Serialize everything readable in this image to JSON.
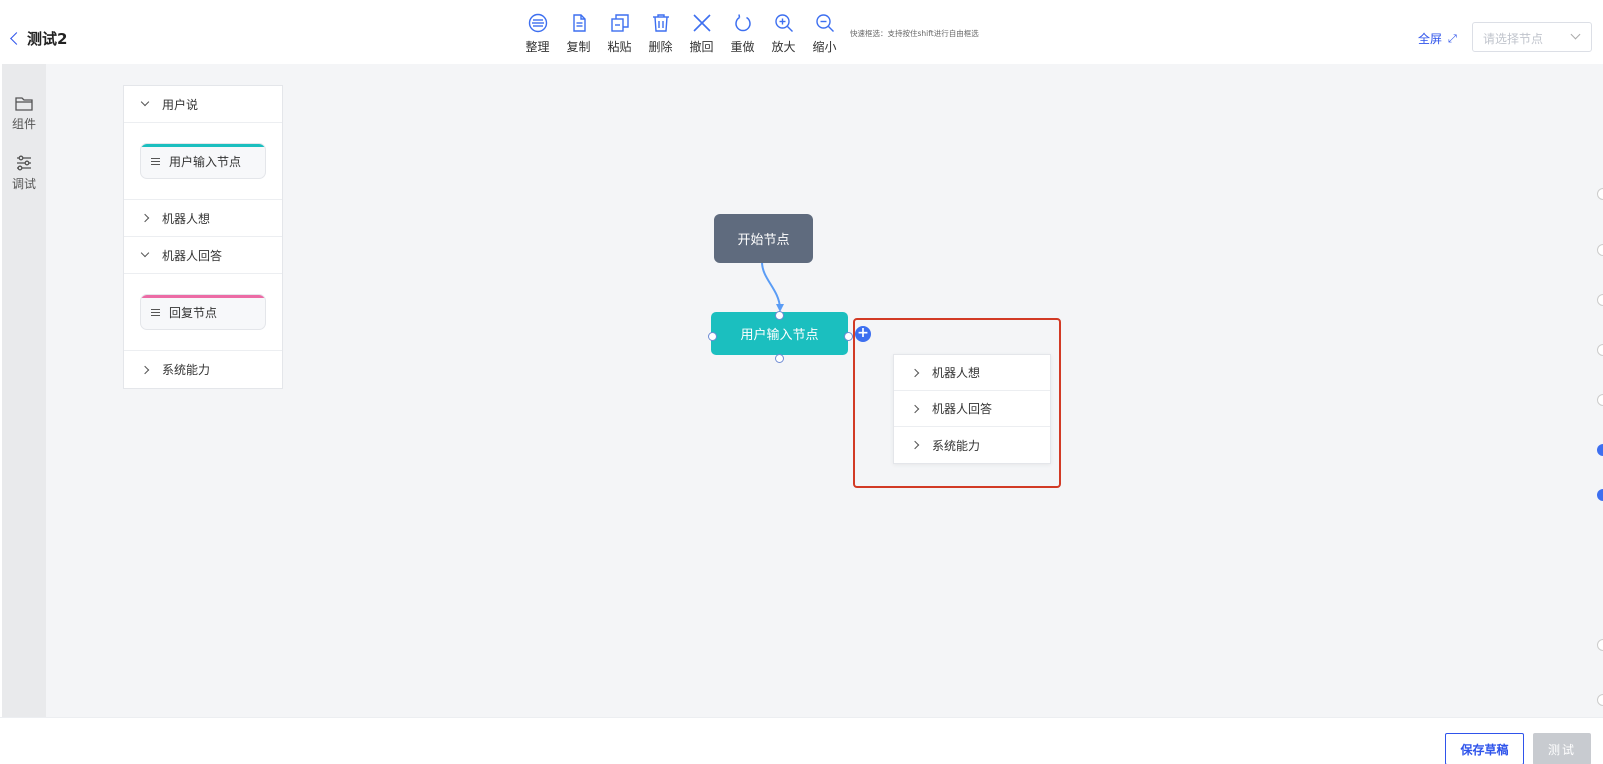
{
  "header": {
    "title": "测试2",
    "fullscreen_label": "全屏",
    "node_select_placeholder": "请选择节点",
    "toolbar": [
      {
        "icon": "organize-icon",
        "label": "整理"
      },
      {
        "icon": "copy-icon",
        "label": "复制"
      },
      {
        "icon": "paste-icon",
        "label": "粘贴"
      },
      {
        "icon": "delete-icon",
        "label": "删除"
      },
      {
        "icon": "undo-icon",
        "label": "撤回"
      },
      {
        "icon": "redo-icon",
        "label": "重做"
      },
      {
        "icon": "zoom-in-icon",
        "label": "放大"
      },
      {
        "icon": "zoom-out-icon",
        "label": "缩小"
      }
    ],
    "quick_select_hint": "快速框选：支持按住shift进行自由框选"
  },
  "rail": {
    "items": [
      {
        "icon": "folder-icon",
        "label": "组件"
      },
      {
        "icon": "sliders-icon",
        "label": "调试"
      }
    ]
  },
  "panel": {
    "sections": [
      {
        "title": "用户说",
        "expanded": true,
        "components": [
          {
            "label": "用户输入节点",
            "accent": "#1bbfbf"
          }
        ]
      },
      {
        "title": "机器人想",
        "expanded": false
      },
      {
        "title": "机器人回答",
        "expanded": true,
        "components": [
          {
            "label": "回复节点",
            "accent": "#ec6ba5"
          }
        ]
      },
      {
        "title": "系统能力",
        "expanded": false
      }
    ]
  },
  "flow": {
    "start_node": {
      "label": "开始节点",
      "color": "#5f6b7e"
    },
    "input_node": {
      "label": "用户输入节点",
      "color": "#1bbfbf"
    },
    "add_symbol": "+"
  },
  "popup": {
    "items": [
      "机器人想",
      "机器人回答",
      "系统能力"
    ]
  },
  "footer": {
    "save_label": "保存草稿",
    "test_label": "测试"
  },
  "colors": {
    "accent": "#2f54eb",
    "highlight_border": "#d23a25",
    "canvas_bg": "#f4f5f7"
  }
}
